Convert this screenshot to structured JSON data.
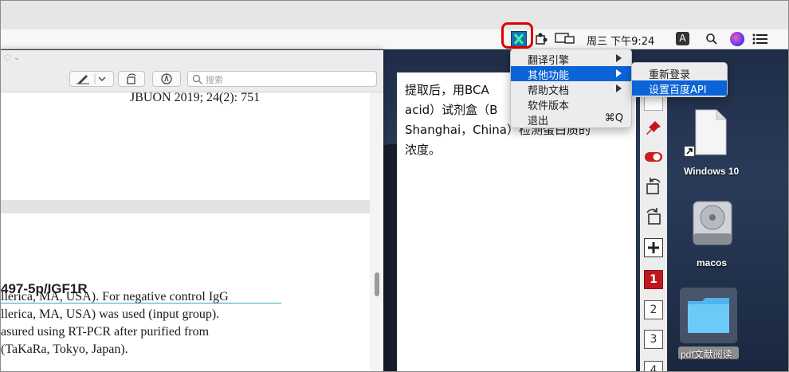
{
  "menubar": {
    "clock": "周三 下午9:24",
    "input_method": "A"
  },
  "pdf": {
    "search_placeholder": "搜索",
    "journal_ref": "JBUON 2019; 24(2): 751",
    "section_heading": "497-5p/IGF1R",
    "body_lines": [
      "llerica, MA, USA). For negative control IgG",
      "llerica, MA, USA) was used (input group).",
      "asured using RT-PCR after purified from",
      " (TaKaRa, Tokyo, Japan)."
    ]
  },
  "translation": {
    "text": "提取后，用BCA acid）试剂盒（B Shanghai，China）检测蛋白质的浓度。",
    "lines": [
      "提取后，用BCA",
      "acid）试剂盒（B",
      "Shanghai，China）检测蛋白质的",
      "浓度。"
    ]
  },
  "tools": {
    "numbers": [
      "1",
      "2",
      "3",
      "4"
    ]
  },
  "app_menu": {
    "items": [
      {
        "label": "翻译引擎",
        "submenu": true
      },
      {
        "label": "其他功能",
        "submenu": true,
        "selected": true
      },
      {
        "label": "帮助文档",
        "submenu": true
      },
      {
        "label": "软件版本",
        "submenu": false
      },
      {
        "label": "退出",
        "submenu": false,
        "shortcut": "⌘Q"
      }
    ]
  },
  "sub_menu": {
    "items": [
      {
        "label": "重新登录"
      },
      {
        "label": "设置百度API",
        "selected": true
      }
    ]
  },
  "desktop": {
    "icons": [
      {
        "label": "Windows 10"
      },
      {
        "label": "macos"
      },
      {
        "label": "pdf文献阅读"
      }
    ]
  },
  "colors": {
    "menu_highlight": "#0a64d8",
    "section_rule": "#3aa3b6",
    "status_red": "#e00000"
  }
}
